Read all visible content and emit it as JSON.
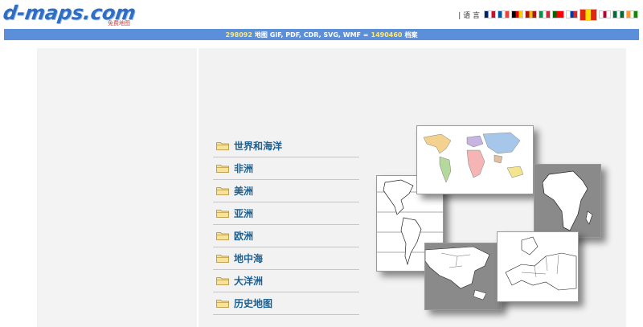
{
  "header": {
    "logo_text": "d-maps.com",
    "logo_subtitle": "免费地图",
    "language_label": "| 语 言"
  },
  "languages": [
    {
      "icon": "flag-uk-icon",
      "colors": [
        "#012169",
        "#ffffff",
        "#c8102e"
      ]
    },
    {
      "icon": "flag-france-icon",
      "colors": [
        "#0055a4",
        "#ffffff",
        "#ef4135"
      ]
    },
    {
      "icon": "flag-germany-icon",
      "colors": [
        "#000000",
        "#dd0000",
        "#ffce00"
      ]
    },
    {
      "icon": "flag-spain-icon",
      "colors": [
        "#aa151b",
        "#f1bf00",
        "#aa151b"
      ]
    },
    {
      "icon": "flag-italy-icon",
      "colors": [
        "#009246",
        "#ffffff",
        "#ce2b37"
      ]
    },
    {
      "icon": "flag-portugal-icon",
      "colors": [
        "#006600",
        "#ff0000",
        "#ff0000"
      ]
    },
    {
      "icon": "flag-russia-icon",
      "colors": [
        "#ffffff",
        "#0039a6",
        "#d52b1e"
      ]
    },
    {
      "icon": "flag-china-icon",
      "colors": [
        "#de2910",
        "#ffde00",
        "#de2910"
      ],
      "big": true
    },
    {
      "icon": "flag-japan-icon",
      "colors": [
        "#ffffff",
        "#bc002d",
        "#ffffff"
      ]
    },
    {
      "icon": "flag-saudi-icon",
      "colors": [
        "#006c35",
        "#ffffff",
        "#006c35"
      ]
    },
    {
      "icon": "flag-india-icon",
      "colors": [
        "#ff9933",
        "#ffffff",
        "#138808"
      ]
    }
  ],
  "stats": {
    "maps_count": "298092",
    "maps_text": "地图 GIF, PDF, CDR, SVG, WMF =",
    "files_count": "1490460",
    "files_text": "档案"
  },
  "menu": {
    "items": [
      {
        "label": "世界和海洋"
      },
      {
        "label": "非洲"
      },
      {
        "label": "美洲"
      },
      {
        "label": "亚洲"
      },
      {
        "label": "欧洲"
      },
      {
        "label": "地中海"
      },
      {
        "label": "大洋洲"
      },
      {
        "label": "历史地图"
      }
    ]
  },
  "map_thumbnails": [
    {
      "icon": "world-map-icon"
    },
    {
      "icon": "americas-map-icon"
    },
    {
      "icon": "africa-map-icon"
    },
    {
      "icon": "asia-map-icon"
    },
    {
      "icon": "europe-map-icon"
    }
  ],
  "colors": {
    "stats_bar": "#5b8fd9",
    "stats_highlight": "#ffe873",
    "menu_text": "#1e5f8e",
    "logo_blue": "#2e6fc4"
  }
}
